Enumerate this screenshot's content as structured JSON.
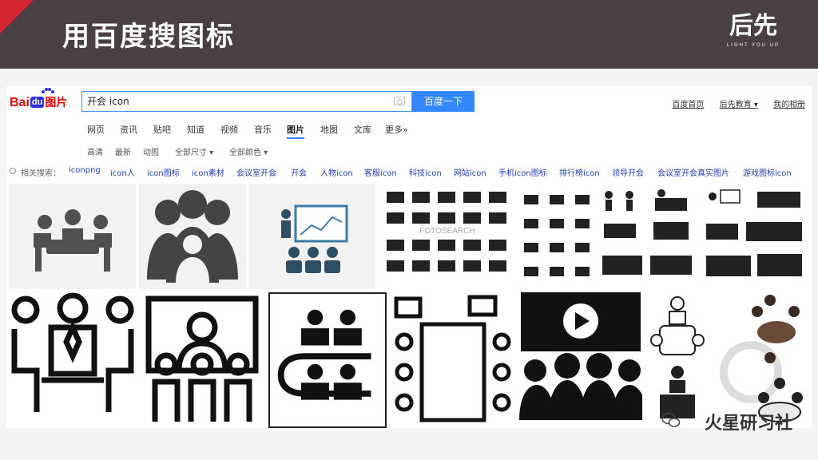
{
  "slide": {
    "title": "用百度搜图标",
    "brand_mark": "后先",
    "brand_sub": "LIGHT YOU UP",
    "watermark": "火星研习社"
  },
  "browser": {
    "logo": {
      "bai": "Bai",
      "du": "du",
      "tupian": "图片"
    },
    "search": {
      "value": "开会 icon",
      "button": "百度一下"
    },
    "top_links": [
      "百度首页",
      "后先教育 ▾",
      "我的相册"
    ],
    "tabs": [
      "网页",
      "资讯",
      "贴吧",
      "知道",
      "视频",
      "音乐",
      "图片",
      "地图",
      "文库",
      "更多»"
    ],
    "active_tab": "图片",
    "filters": [
      "高清",
      "最新",
      "动图",
      "全部尺寸 ▾",
      "全部颜色 ▾"
    ],
    "related_label": "相关搜索：",
    "related": [
      "iconpng",
      "icon人",
      "icon图标",
      "icon素材",
      "会议室开会",
      "开会",
      "人物icon",
      "客服icon",
      "科技icon",
      "网站icon",
      "手机icon图标",
      "排行榜icon",
      "领导开会",
      "会议室开会真实图片",
      "游戏图标icon"
    ],
    "thumb_text": {
      "fotosearch": "FOTOSEARCH"
    }
  },
  "colors": {
    "header_bg": "#4a4044",
    "accent_red": "#d7262f",
    "baidu_blue": "#3388ff",
    "link_blue": "#2440b3"
  }
}
